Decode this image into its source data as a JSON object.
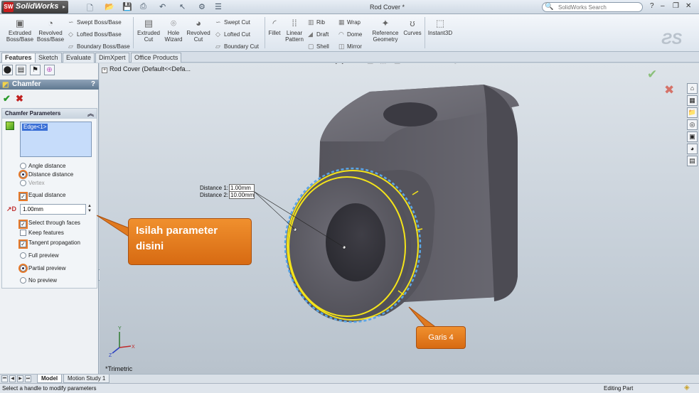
{
  "app": {
    "logo": "SolidWorks",
    "doc_title": "Rod Cover *"
  },
  "search": {
    "placeholder": "SolidWorks Search"
  },
  "commands": {
    "extruded_boss": "Extruded Boss/Base",
    "revolved_boss": "Revolved Boss/Base",
    "swept_boss": "Swept Boss/Base",
    "lofted_boss": "Lofted Boss/Base",
    "boundary_boss": "Boundary Boss/Base",
    "extruded_cut": "Extruded Cut",
    "hole_wizard": "Hole Wizard",
    "revolved_cut": "Revolved Cut",
    "swept_cut": "Swept Cut",
    "lofted_cut": "Lofted Cut",
    "boundary_cut": "Boundary Cut",
    "fillet": "Fillet",
    "linear_pattern": "Linear Pattern",
    "rib": "Rib",
    "draft": "Draft",
    "shell": "Shell",
    "wrap": "Wrap",
    "dome": "Dome",
    "mirror": "Mirror",
    "reference_geometry": "Reference Geometry",
    "curves": "Curves",
    "instant3d": "Instant3D"
  },
  "tabs": [
    "Features",
    "Sketch",
    "Evaluate",
    "DimXpert",
    "Office Products"
  ],
  "tree": {
    "node": "Rod Cover  (Default<<Defa..."
  },
  "property_manager": {
    "title": "Chamfer",
    "help": "?",
    "group_title": "Chamfer Parameters",
    "edge_item": "Edge<1>",
    "options": {
      "angle_distance": "Angle distance",
      "distance_distance": "Distance distance",
      "vertex": "Vertex",
      "equal_distance": "Equal distance",
      "distance_value": "1.00mm",
      "select_through_faces": "Select through faces",
      "keep_features": "Keep features",
      "tangent_propagation": "Tangent propagation",
      "full_preview": "Full preview",
      "partial_preview": "Partial preview",
      "no_preview": "No preview"
    }
  },
  "viewport": {
    "view_label": "*Trimetric",
    "dimension": {
      "d1_label": "Distance 1:",
      "d1_value": "1.00mm",
      "d2_label": "Distance 2:",
      "d2_value": "10.00mm"
    },
    "note_param": {
      "line1": "Isilah parameter",
      "line2": "disini"
    },
    "note_garis": "Garis 4"
  },
  "bottom_tabs": [
    "Model",
    "Motion Study 1"
  ],
  "status": {
    "message": "Select a handle to modify parameters",
    "mode": "Editing Part"
  },
  "colors": {
    "accent": "#e87a2a",
    "selection": "#f4e41a",
    "part": "#5b5a62"
  }
}
